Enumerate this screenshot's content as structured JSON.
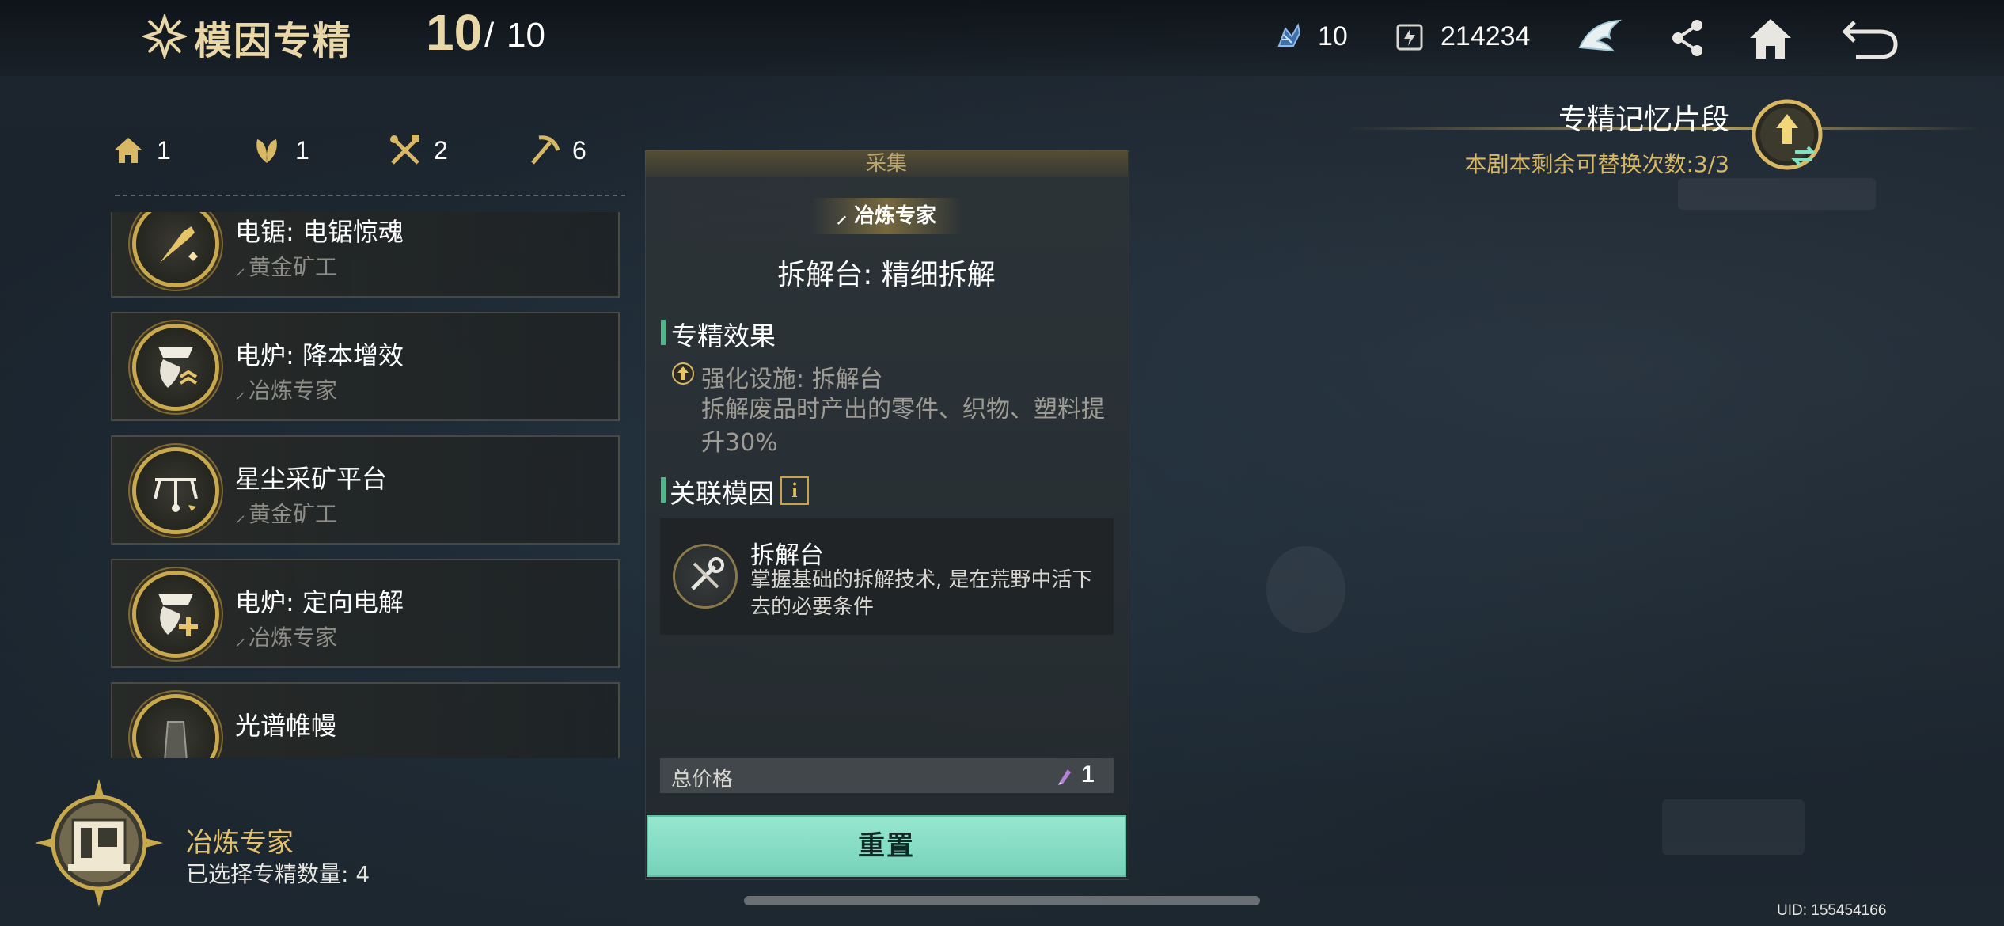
{
  "header": {
    "title": "模因专精",
    "count_current": "10",
    "count_separator": "/",
    "count_max": "10",
    "resource1_value": "10",
    "resource2_value": "214234",
    "icons": [
      "crystal-icon",
      "energy-icon",
      "emblem-icon",
      "share-icon",
      "home-icon",
      "back-icon"
    ]
  },
  "filters": [
    {
      "icon": "house-icon",
      "value": "1"
    },
    {
      "icon": "leaf-icon",
      "value": "1"
    },
    {
      "icon": "tools-icon",
      "value": "2"
    },
    {
      "icon": "pickaxe-icon",
      "value": "6"
    }
  ],
  "list": {
    "items": [
      {
        "name": "电锯: 电锯惊魂",
        "sub": "黄金矿工"
      },
      {
        "name": "电炉: 降本增效",
        "sub": "冶炼专家"
      },
      {
        "name": "星尘采矿平台",
        "sub": "黄金矿工"
      },
      {
        "name": "电炉: 定向电解",
        "sub": "冶炼专家"
      },
      {
        "name": "光谱帷幔",
        "sub": ""
      }
    ]
  },
  "profile": {
    "name": "冶炼专家",
    "selected_count": "已选择专精数量: 4"
  },
  "detail": {
    "category": "采集",
    "badge": "冶炼专家",
    "title": "拆解台: 精细拆解",
    "effect_title": "专精效果",
    "effect_line1": "强化设施: 拆解台",
    "effect_line2": "拆解废品时产出的零件、织物、塑料提升30%",
    "related_title": "关联模因",
    "info_glyph": "i",
    "gene_name": "拆解台",
    "gene_desc": "掌握基础的拆解技术, 是在荒野中活下去的必要条件",
    "price_label": "总价格",
    "price_value": "1",
    "reset_label": "重置"
  },
  "memory": {
    "title": "专精记忆片段",
    "subtitle": "本剧本剩余可替换次数:3/3"
  },
  "footer": {
    "uid": "UID: 155454166"
  },
  "colors": {
    "gold": "#e3c06d",
    "accent_green": "#77d2ba",
    "section_bar": "#4fb58a"
  }
}
